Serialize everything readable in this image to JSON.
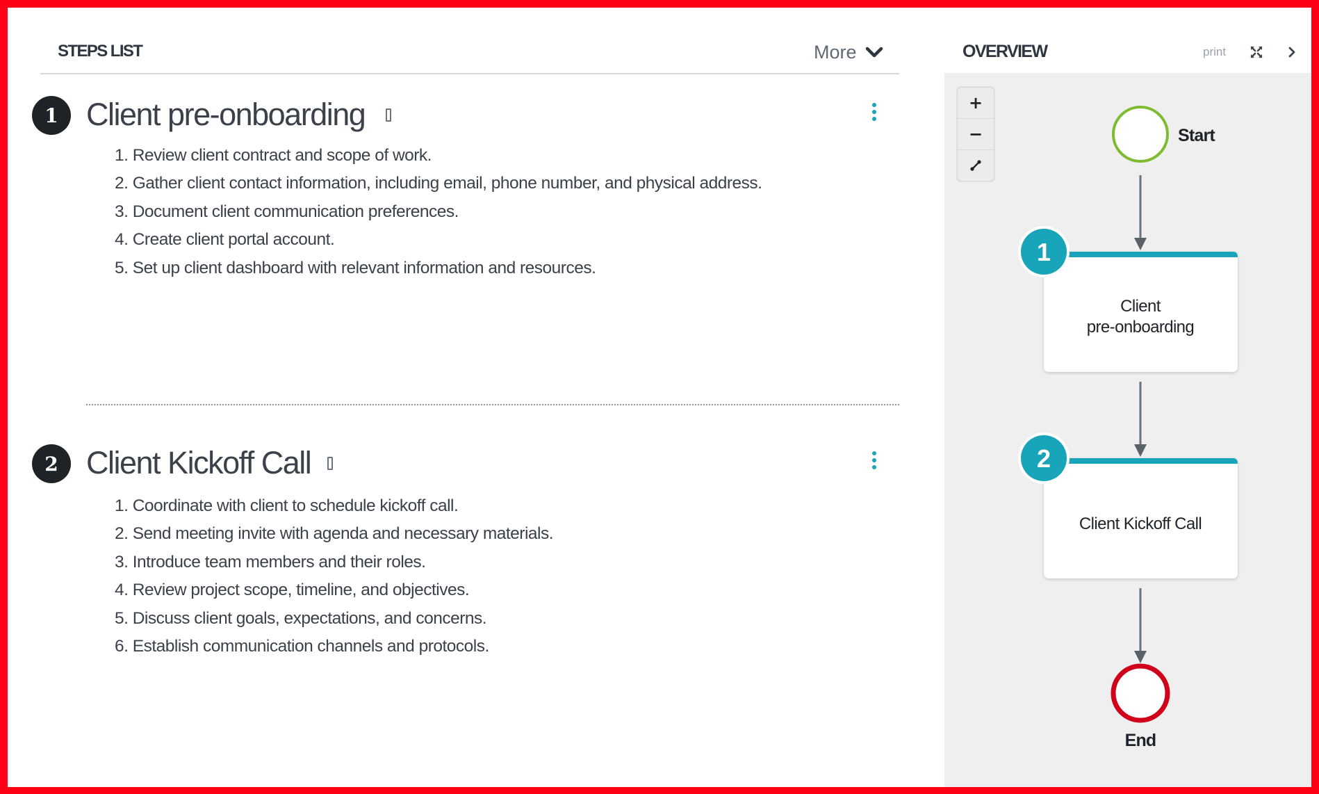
{
  "steps_panel": {
    "title": "STEPS LIST",
    "more_label": "More",
    "steps": [
      {
        "number": "1",
        "title": "Client pre-onboarding",
        "items": [
          "1. Review client contract and scope of work.",
          "2. Gather client contact information, including email, phone number, and physical address.",
          "3. Document client communication preferences.",
          "4. Create client portal account.",
          "5. Set up client dashboard with relevant information and resources."
        ]
      },
      {
        "number": "2",
        "title": "Client Kickoff Call",
        "items": [
          "1. Coordinate with client to schedule kickoff call.",
          "2. Send meeting invite with agenda and necessary materials.",
          "3. Introduce team members and their roles.",
          "4. Review project scope, timeline, and objectives.",
          "5. Discuss client goals, expectations, and concerns.",
          "6. Establish communication channels and protocols."
        ]
      }
    ],
    "icons": {
      "more": "chevron-down-icon",
      "step_menu": "kebab-menu-icon",
      "title_glyph": "missing-glyph-icon"
    }
  },
  "overview_panel": {
    "title": "OVERVIEW",
    "print_label": "print",
    "icons": {
      "fullscreen": "expand-arrows-icon",
      "collapse": "chevron-right-icon"
    },
    "zoom_controls": {
      "zoom_in": "+",
      "zoom_out": "−",
      "fit_icon": "fit-to-screen-icon"
    },
    "flow": {
      "start_label": "Start",
      "end_label": "End",
      "nodes": [
        {
          "number": "1",
          "label_lines": [
            "Client",
            "pre-onboarding"
          ]
        },
        {
          "number": "2",
          "label_lines": [
            "Client Kickoff Call"
          ]
        }
      ]
    }
  },
  "colors": {
    "frame_border": "#ff0016",
    "accent_teal": "#18a4b9",
    "start_green": "#7dbb2f",
    "end_red": "#d0021b",
    "canvas_bg": "#efefef",
    "badge_dark": "#1e2328"
  }
}
